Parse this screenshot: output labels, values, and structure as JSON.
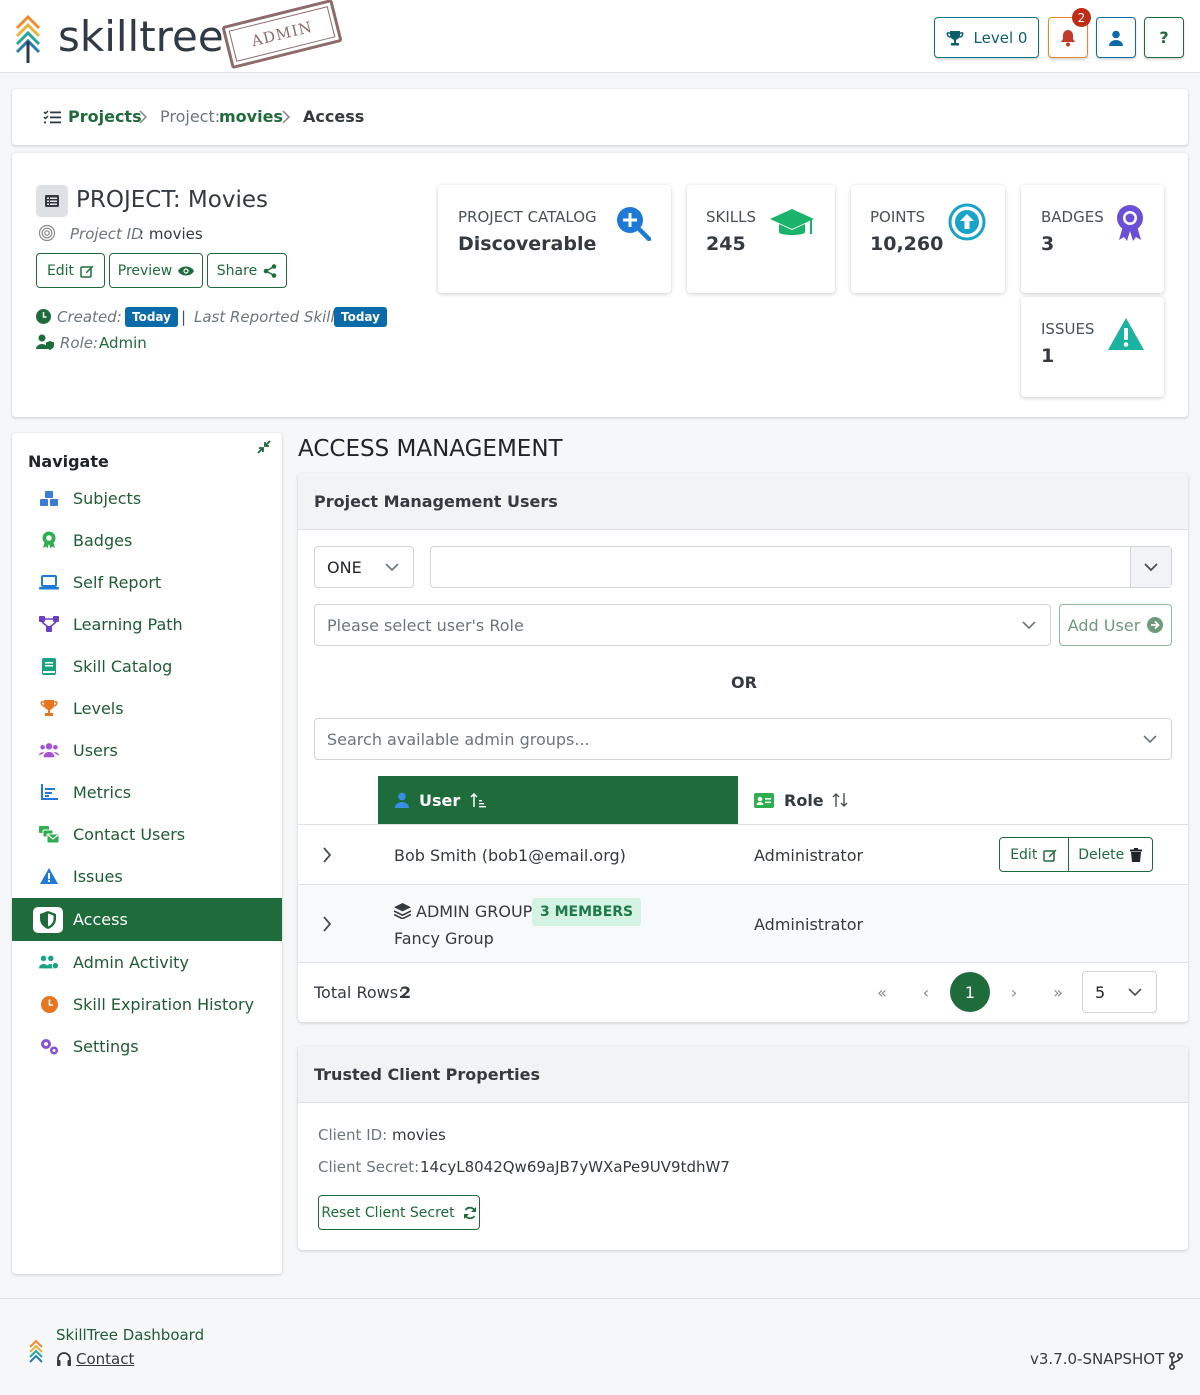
{
  "header": {
    "logo_text": "skilltree",
    "stamp": "ADMIN",
    "level_label": "Level 0",
    "notification_count": "2",
    "help_label": "?"
  },
  "breadcrumb": {
    "projects": "Projects",
    "project_prefix": "Project:",
    "project_name": "movies",
    "current": "Access"
  },
  "project": {
    "title": "PROJECT: Movies",
    "id_label": "Project ID",
    "id_value": ": movies",
    "buttons": {
      "edit": "Edit",
      "preview": "Preview",
      "share": "Share"
    },
    "created_label": "Created:",
    "created_value": "Today",
    "separator": "|",
    "last_reported_label": "Last Reported Skill:",
    "last_reported_value": "Today",
    "role_label": "Role:",
    "role_value": "Admin"
  },
  "stats": {
    "catalog": {
      "label": "PROJECT CATALOG",
      "value": "Discoverable"
    },
    "skills": {
      "label": "SKILLS",
      "value": "245"
    },
    "points": {
      "label": "POINTS",
      "value": "10,260"
    },
    "badges": {
      "label": "BADGES",
      "value": "3"
    },
    "issues": {
      "label": "ISSUES",
      "value": "1"
    }
  },
  "sidebar": {
    "heading": "Navigate",
    "items": [
      {
        "label": "Subjects"
      },
      {
        "label": "Badges"
      },
      {
        "label": "Self Report"
      },
      {
        "label": "Learning Path"
      },
      {
        "label": "Skill Catalog"
      },
      {
        "label": "Levels"
      },
      {
        "label": "Users"
      },
      {
        "label": "Metrics"
      },
      {
        "label": "Contact Users"
      },
      {
        "label": "Issues"
      },
      {
        "label": "Access"
      },
      {
        "label": "Admin Activity"
      },
      {
        "label": "Skill Expiration History"
      },
      {
        "label": "Settings"
      }
    ]
  },
  "main": {
    "title": "ACCESS MANAGEMENT",
    "pm_users": {
      "heading": "Project Management Users",
      "mode_select": "ONE",
      "user_input_value": "",
      "role_placeholder": "Please select user's Role",
      "add_user": "Add User",
      "or": "OR",
      "group_placeholder": "Search available admin groups...",
      "columns": {
        "user": "User",
        "role": "Role"
      },
      "rows": [
        {
          "user": "Bob Smith (bob1@email.org)",
          "role": "Administrator",
          "edit": "Edit",
          "delete": "Delete"
        },
        {
          "group_type": "ADMIN GROUP",
          "members": "3 MEMBERS",
          "group_name": "Fancy Group",
          "role": "Administrator"
        }
      ],
      "total_rows_label": "Total Rows:",
      "total_rows_value": "2",
      "current_page": "1",
      "page_size": "5"
    },
    "trusted_client": {
      "heading": "Trusted Client Properties",
      "client_id_label": "Client ID:",
      "client_id_value": "movies",
      "client_secret_label": "Client Secret:",
      "client_secret_value": "14cyL8042Qw69aJB7yWXaPe9UV9tdhW7",
      "reset_button": "Reset Client Secret"
    }
  },
  "footer": {
    "dashboard": "SkillTree Dashboard",
    "contact": "Contact",
    "version": "v3.7.0-SNAPSHOT"
  }
}
